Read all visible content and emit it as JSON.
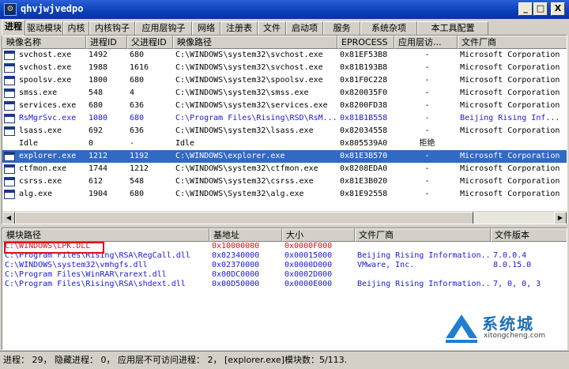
{
  "window": {
    "title": "qhvjwjvedpo",
    "min": "_",
    "max": "□",
    "close": "X"
  },
  "tabs": [
    "进程",
    "驱动模块",
    "内核",
    "内核钩子",
    "应用层钩子",
    "网络",
    "注册表",
    "文件",
    "启动项",
    "服务",
    "系统杂项",
    "本工具配置"
  ],
  "process_table": {
    "columns": [
      "映像名称",
      "进程ID",
      "父进程ID",
      "映像路径",
      "EPROCESS",
      "应用层访...",
      "文件厂商"
    ],
    "rows": [
      {
        "name": "svchost.exe",
        "pid": "1492",
        "ppid": "680",
        "path": "C:\\WINDOWS\\system32\\svchost.exe",
        "eprocess": "0x81EF53B8",
        "access": "-",
        "vendor": "Microsoft Corporation",
        "icon": true
      },
      {
        "name": "svchost.exe",
        "pid": "1988",
        "ppid": "1616",
        "path": "C:\\WINDOWS\\system32\\svchost.exe",
        "eprocess": "0x81B193B8",
        "access": "-",
        "vendor": "Microsoft Corporation",
        "icon": true
      },
      {
        "name": "spoolsv.exe",
        "pid": "1800",
        "ppid": "680",
        "path": "C:\\WINDOWS\\system32\\spoolsv.exe",
        "eprocess": "0x81F0C228",
        "access": "-",
        "vendor": "Microsoft Corporation",
        "icon": true
      },
      {
        "name": "smss.exe",
        "pid": "548",
        "ppid": "4",
        "path": "C:\\WINDOWS\\system32\\smss.exe",
        "eprocess": "0x820035F0",
        "access": "-",
        "vendor": "Microsoft Corporation",
        "icon": true
      },
      {
        "name": "services.exe",
        "pid": "680",
        "ppid": "636",
        "path": "C:\\WINDOWS\\system32\\services.exe",
        "eprocess": "0x8200FD38",
        "access": "-",
        "vendor": "Microsoft Corporation",
        "icon": true
      },
      {
        "name": "RsMgrSvc.exe",
        "pid": "1080",
        "ppid": "680",
        "path": "C:\\Program Files\\Rising\\RSD\\RsM...",
        "eprocess": "0x81B1B558",
        "access": "-",
        "vendor": "Beijing Rising Inf...",
        "icon": true,
        "blue": true
      },
      {
        "name": "lsass.exe",
        "pid": "692",
        "ppid": "636",
        "path": "C:\\WINDOWS\\system32\\lsass.exe",
        "eprocess": "0x82034558",
        "access": "-",
        "vendor": "Microsoft Corporation",
        "icon": true
      },
      {
        "name": "Idle",
        "pid": "0",
        "ppid": "-",
        "path": "Idle",
        "eprocess": "0x805539A0",
        "access": "拒绝",
        "vendor": "",
        "icon": false
      },
      {
        "name": "explorer.exe",
        "pid": "1212",
        "ppid": "1192",
        "path": "C:\\WINDOWS\\explorer.exe",
        "eprocess": "0x81E3B570",
        "access": "-",
        "vendor": "Microsoft Corporation",
        "icon": true,
        "selected": true
      },
      {
        "name": "ctfmon.exe",
        "pid": "1744",
        "ppid": "1212",
        "path": "C:\\WINDOWS\\system32\\ctfmon.exe",
        "eprocess": "0x8208EDA0",
        "access": "-",
        "vendor": "Microsoft Corporation",
        "icon": true
      },
      {
        "name": "csrss.exe",
        "pid": "612",
        "ppid": "548",
        "path": "C:\\WINDOWS\\system32\\csrss.exe",
        "eprocess": "0x81E3B020",
        "access": "-",
        "vendor": "Microsoft Corporation",
        "icon": true
      },
      {
        "name": "alg.exe",
        "pid": "1904",
        "ppid": "680",
        "path": "C:\\WINDOWS\\System32\\alg.exe",
        "eprocess": "0x81E92558",
        "access": "-",
        "vendor": "Microsoft Corporation",
        "icon": true
      }
    ]
  },
  "module_table": {
    "columns": [
      "模块路径",
      "基地址",
      "大小",
      "文件厂商",
      "文件版本"
    ],
    "rows": [
      {
        "path": "C:\\WINDOWS\\LPK.DLL",
        "base": "0x10000000",
        "size": "0x0000F000",
        "vendor": "",
        "version": "",
        "red": true
      },
      {
        "path": "C:\\Program Files\\Rising\\RSA\\RegCall.dll",
        "base": "0x02340000",
        "size": "0x00015000",
        "vendor": "Beijing Rising Information...",
        "version": "7.0.0.4"
      },
      {
        "path": "C:\\WINDOWS\\system32\\vmhgfs.dll",
        "base": "0x02370000",
        "size": "0x0000D000",
        "vendor": "VMware, Inc.",
        "version": "8.0.15.0"
      },
      {
        "path": "C:\\Program Files\\WinRAR\\rarext.dll",
        "base": "0x00DC0000",
        "size": "0x0002D000",
        "vendor": "",
        "version": ""
      },
      {
        "path": "C:\\Program Files\\Rising\\RSA\\shdext.dll",
        "base": "0x00D50000",
        "size": "0x0000E000",
        "vendor": "Beijing Rising Information...",
        "version": "7, 0, 0, 3"
      }
    ]
  },
  "status": {
    "text": "进程： 29， 隐藏进程： 0， 应用层不可访问进程： 2， [explorer.exe]模块数：5/113."
  },
  "watermark": {
    "brand": "系统城",
    "site": "xitongcheng.com"
  }
}
